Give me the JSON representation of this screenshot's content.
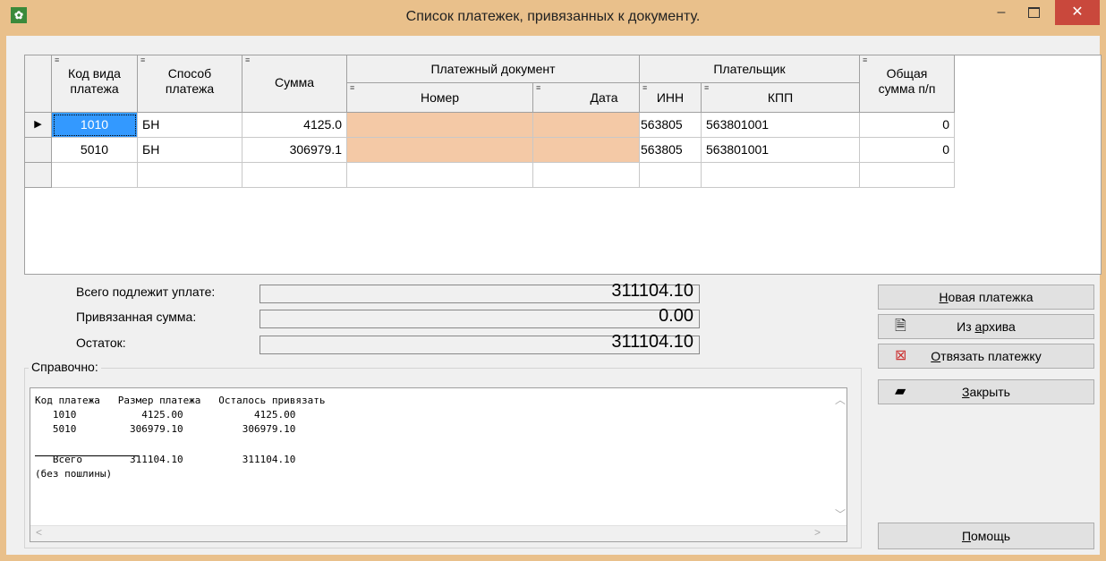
{
  "window": {
    "title": "Список платежек, привязанных к документу.",
    "minimize": "–",
    "close": "✕"
  },
  "grid": {
    "headers": {
      "kod": [
        "Код вида",
        "платежа"
      ],
      "sposob": [
        "Способ",
        "платежа"
      ],
      "summa": "Сумма",
      "platdoc": "Платежный документ",
      "nomer": "Номер",
      "data": "Дата",
      "platelshik": "Плательщик",
      "inn": "ИНН",
      "kpp": "КПП",
      "obshaya": [
        "Общая",
        "сумма п/п"
      ],
      "marker": "≡"
    },
    "current_row_marker": "▶",
    "rows": [
      {
        "kod": "1010",
        "sposob": "БН",
        "summa": "4125.0",
        "nomer": "",
        "data": "",
        "inn": "563805",
        "kpp": "563801001",
        "obshaya": "0"
      },
      {
        "kod": "5010",
        "sposob": "БН",
        "summa": "306979.1",
        "nomer": "",
        "data": "",
        "inn": "563805",
        "kpp": "563801001",
        "obshaya": "0"
      }
    ]
  },
  "totals": {
    "vsego_label": "Всего подлежит уплате:",
    "vsego_value": "311104.10",
    "privyaz_label": "Привязанная сумма:",
    "privyaz_value": "0.00",
    "ostatok_label": "Остаток:",
    "ostatok_value": "311104.10"
  },
  "reference": {
    "label": "Справочно:",
    "header": "Код платежа   Размер платежа   Осталось привязать",
    "line1": "   1010           4125.00            4125.00",
    "line2": "   5010         306979.10          306979.10",
    "total": "   Всего        311104.10          311104.10",
    "note": "(без пошлины)"
  },
  "buttons": {
    "new_pre": "Н",
    "new_rest": "овая платежка",
    "archive_pre": "Из ",
    "archive_u": "а",
    "archive_rest": "рхива",
    "unlink_u": "О",
    "unlink_rest": "твязать платежку",
    "close_u": "З",
    "close_rest": "акрыть",
    "help_u": "П",
    "help_rest": "омощь"
  }
}
